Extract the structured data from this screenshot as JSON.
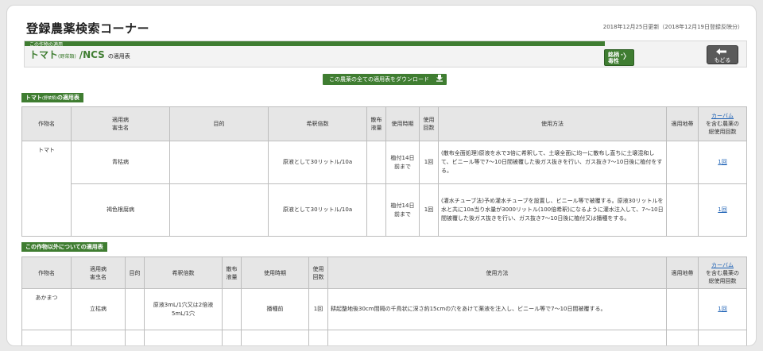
{
  "header": {
    "title": "登録農薬検索コーナー",
    "updated": "2018年12月25日更新（2018年12月19日登録反映分）"
  },
  "crop_header": {
    "band_label": "この作物の適用",
    "crop": "トマト",
    "crop_sub": "(野菜類)",
    "product": "/NCS",
    "suffix": "の適用表",
    "spec_button": [
      "銘柄・",
      "毒性"
    ],
    "back_button": "もどる",
    "back_icon_label": "戻る"
  },
  "download_button": "この農薬の全ての適用表をダウンロード",
  "section1": {
    "label": "トマト",
    "label_sub": "(野菜類)",
    "label_suffix": "の適用表",
    "headers": {
      "crop": "作物名",
      "pest": [
        "適用病",
        "害虫名"
      ],
      "purpose": "目的",
      "dilution": "希釈倍数",
      "spray": [
        "散布",
        "液量"
      ],
      "timing": "使用時期",
      "count": [
        "使用",
        "回数"
      ],
      "method": "使用方法",
      "region": "適用地帯",
      "carbam_link": "カーバム",
      "carbam_rest": [
        "を含む農薬の",
        "総使用回数"
      ]
    },
    "rows": [
      {
        "crop": "トマト",
        "pest": "青枯病",
        "purpose": "",
        "dilution": "原液として30リットル/10a",
        "spray": "",
        "timing": "植付14日前まで",
        "count": "1回",
        "method": "(散布全面処理)原液を水で3倍に希釈して、土壌全面に均一に散布し直ちに土壌混和して、ビニール等で7〜10日間被覆した後ガス抜きを行い、ガス抜き7〜10日後に植付をする。",
        "region": "",
        "total": "1回"
      },
      {
        "crop": "",
        "pest": "褐色根腐病",
        "purpose": "",
        "dilution": "原液として30リットル/10a",
        "spray": "",
        "timing": "植付14日前まで",
        "count": "1回",
        "method": "(灌水チューブ法)予め灌水チューブを設置し、ビニール等で被覆する。原液30リットルを水と共に10a当り水量が3000リットル(100倍希釈)になるように灌水注入して、7〜10日間被覆した後ガス抜きを行い、ガス抜き7〜10日後に植付又は播種をする。",
        "region": "",
        "total": "1回"
      }
    ]
  },
  "section2": {
    "label": "この作物以外についての適用表",
    "headers": {
      "crop": "作物名",
      "pest": [
        "適用病",
        "害虫名"
      ],
      "purpose": "目的",
      "dilution": "希釈倍数",
      "spray": [
        "散布",
        "液量"
      ],
      "timing": "使用時期",
      "count": [
        "使用",
        "回数"
      ],
      "method": "使用方法",
      "region": "適用地帯",
      "carbam_link": "カーバム",
      "carbam_rest": [
        "を含む農薬の",
        "総使用回数"
      ]
    },
    "rows": [
      {
        "crop": "あかまつ",
        "pest": "立枯病",
        "purpose": "",
        "dilution": [
          "原液3mL/1穴又は2倍液",
          "5mL/1穴"
        ],
        "spray": "",
        "timing": "播種前",
        "count": "1回",
        "method": "耕起整地後30cm間隔の千鳥状に深さ約15cmの穴をあけて薬液を注入し、ビニール等で7〜10日間被覆する。",
        "region": "",
        "total": "1回"
      }
    ]
  },
  "colors": {
    "accent_green": "#3f7d31",
    "link_blue": "#1a5fb4",
    "header_gray": "#e6e6e6"
  }
}
